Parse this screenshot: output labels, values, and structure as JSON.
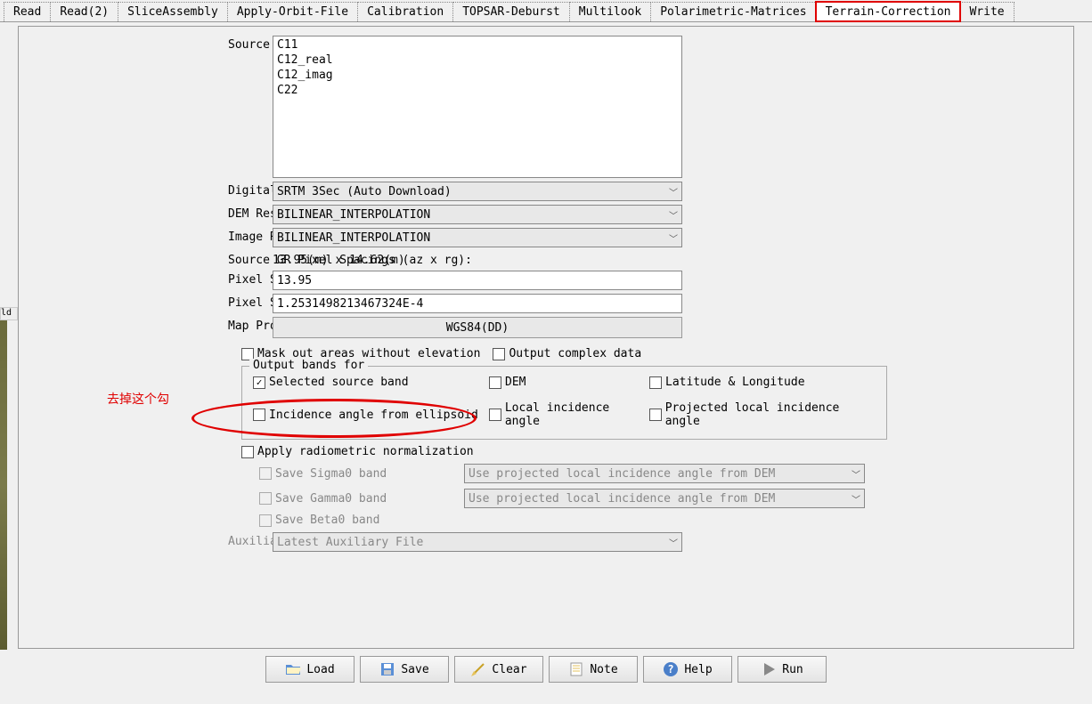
{
  "tabs": [
    {
      "label": "Read"
    },
    {
      "label": "Read(2)"
    },
    {
      "label": "SliceAssembly"
    },
    {
      "label": "Apply-Orbit-File"
    },
    {
      "label": "Calibration"
    },
    {
      "label": "TOPSAR-Deburst"
    },
    {
      "label": "Multilook"
    },
    {
      "label": "Polarimetric-Matrices"
    },
    {
      "label": "Terrain-Correction"
    },
    {
      "label": "Write"
    }
  ],
  "active_tab_index": 8,
  "labels": {
    "source_bands": "Source Bands:",
    "dem": "Digital Elevation Model:",
    "dem_resamp": "DEM Resampling Method:",
    "img_resamp": "Image Resampling Method:",
    "gr_spacing": "Source GR Pixel Spacings (az x rg):",
    "px_m": "Pixel Spacing (m):",
    "px_deg": "Pixel Spacing (deg):",
    "map_proj": "Map Projection:",
    "mask_no_elev": "Mask out areas without elevation",
    "out_complex": "Output complex data",
    "out_bands_for": "Output bands for",
    "sel_src_band": "Selected source band",
    "dem_cb": "DEM",
    "latlon": "Latitude & Longitude",
    "inc_ell": "Incidence angle from ellipsoid",
    "local_inc": "Local incidence angle",
    "proj_local_inc": "Projected local incidence angle",
    "apply_radio": "Apply radiometric normalization",
    "save_sigma0": "Save Sigma0 band",
    "save_gamma0": "Save Gamma0 band",
    "save_beta0": "Save Beta0 band",
    "aux_file": "Auxiliary File (ASAR only):"
  },
  "values": {
    "source_bands": [
      "C11",
      "C12_real",
      "C12_imag",
      "C22"
    ],
    "dem": "SRTM 3Sec (Auto Download)",
    "dem_resamp": "BILINEAR_INTERPOLATION",
    "img_resamp": "BILINEAR_INTERPOLATION",
    "gr_spacing": "13.95(m) x 14.62(m)",
    "px_m": "13.95",
    "px_deg": "1.2531498213467324E-4",
    "map_proj": "WGS84(DD)",
    "sigma0_combo": "Use projected local incidence angle from DEM",
    "gamma0_combo": "Use projected local incidence angle from DEM",
    "aux_file": "Latest Auxiliary File"
  },
  "checks": {
    "mask_no_elev": false,
    "out_complex": false,
    "sel_src_band": true,
    "dem_cb": false,
    "latlon": false,
    "inc_ell": false,
    "local_inc": false,
    "proj_local_inc": false,
    "apply_radio": false,
    "save_sigma0": false,
    "save_gamma0": false,
    "save_beta0": false
  },
  "buttons": {
    "load": "Load",
    "save": "Save",
    "clear": "Clear",
    "note": "Note",
    "help": "Help",
    "run": "Run"
  },
  "annotation": {
    "text": "去掉这个勾"
  },
  "side_label": "ld"
}
